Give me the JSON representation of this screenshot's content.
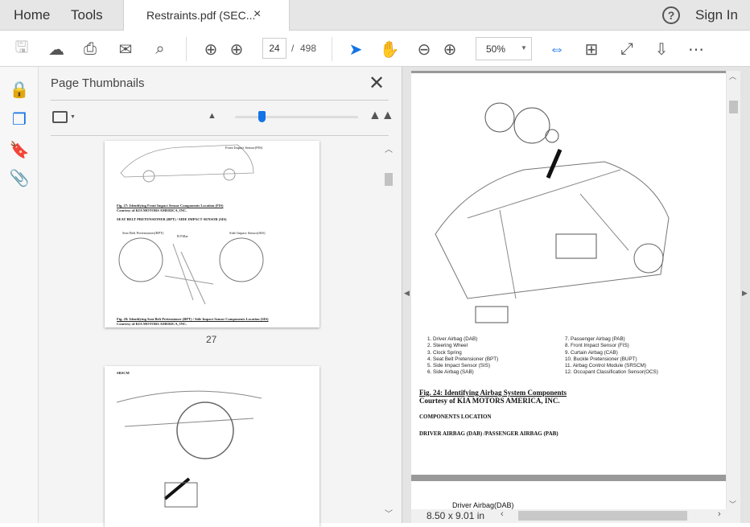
{
  "tabs": {
    "home": "Home",
    "tools": "Tools",
    "document": "Restraints.pdf (SEC...",
    "close": "×",
    "help": "?",
    "sign_in": "Sign In"
  },
  "toolbar": {
    "page_current": "24",
    "page_sep": "/",
    "page_total": "498",
    "zoom": "50%"
  },
  "panel": {
    "title": "Page Thumbnails",
    "slider_percent": 8
  },
  "thumbnails": [
    {
      "label": "Front Impact Sensor(FIS)",
      "caption": "Fig. 27: Identifying Front Impact Sensor Components Location (FIS)",
      "courtesy": "Courtesy of KIA MOTORS AMERICA, INC.",
      "heading": "SEAT BELT PRETENSIONER (BPT) / SIDE IMPACT SENSOR (SIS)",
      "callouts": [
        "Seat Belt Pretensioner(BPT)",
        "B Pillar",
        "Side Impact Sensor(SIS)"
      ],
      "caption2": "Fig. 28: Identifying Seat Belt Pretensioner (BPT) / Side Impact Sensor Components Location (SIS)",
      "courtesy2": "Courtesy of KIA MOTORS AMERICA, INC.",
      "page_number": "27"
    },
    {
      "heading": "SRSCM"
    }
  ],
  "document": {
    "legend_left": [
      "1. Driver Airbag (DAB)",
      "2. Steering Wheel",
      "3. Clock Spring",
      "4. Seat Belt Pretensioner (BPT)",
      "5. Side Impact Sensor (SIS)",
      "6. Side Airbag (SAB)"
    ],
    "legend_right": [
      "7. Passenger Airbag (PAB)",
      "8. Front Impact Sensor (FIS)",
      "9. Curtain Airbag (CAB)",
      "10. Buckle Pretensioner (BUPT)",
      "11. Airbag Control Module (SRSCM)",
      "12. Occupant Classification Sensor(OCS)"
    ],
    "figure_caption": "Fig. 24: Identifying Airbag System Components",
    "courtesy": "Courtesy of KIA MOTORS AMERICA, INC.",
    "section": "COMPONENTS LOCATION",
    "subsection": "DRIVER AIRBAG (DAB) /PASSENGER AIRBAG (PAB)",
    "next_page_heading": "Driver Airbag(DAB)",
    "page_size": "8.50 x 9.01 in"
  },
  "colors": {
    "accent": "#1473e6",
    "tabbar": "#e6e6e6"
  }
}
